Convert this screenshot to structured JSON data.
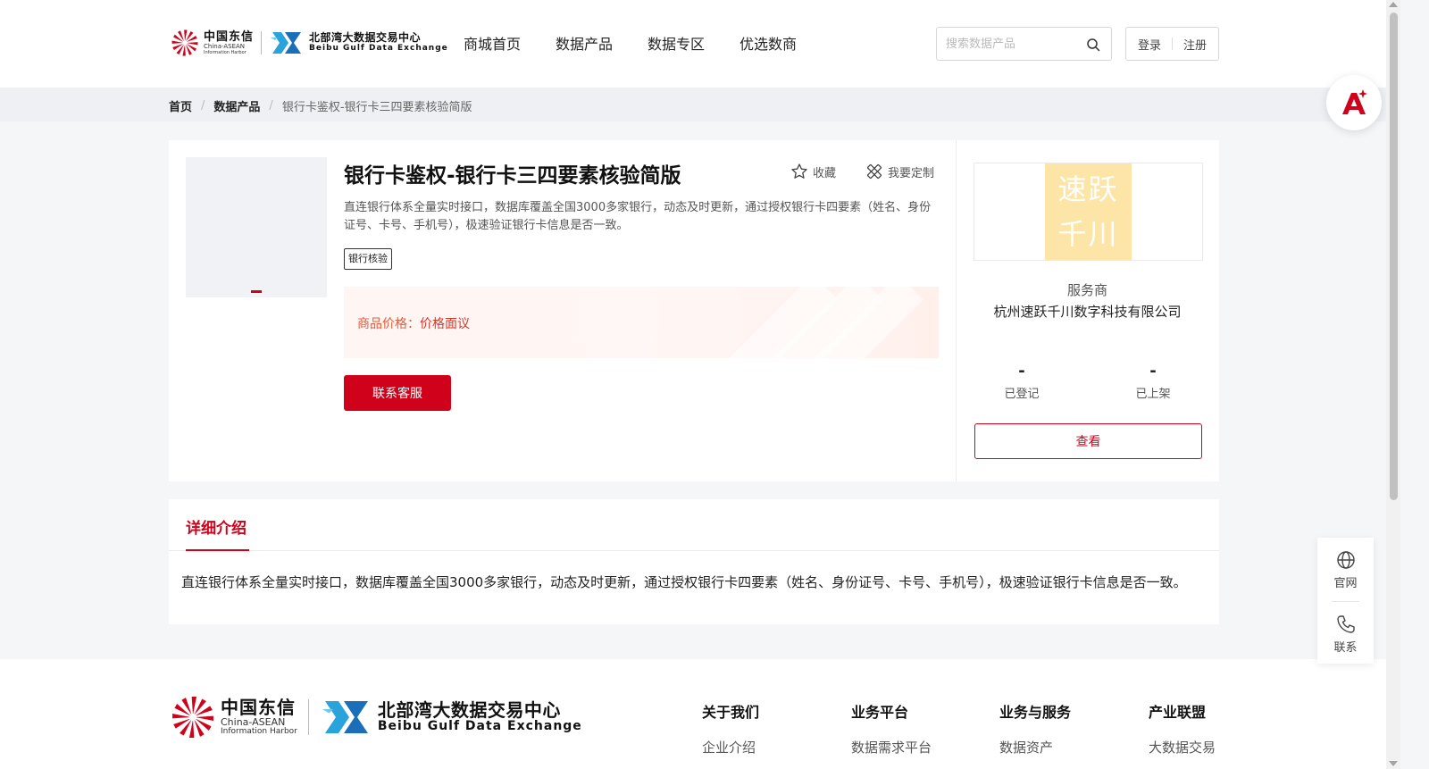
{
  "header": {
    "logo_china_telecom": {
      "cn": "中国东信",
      "en1": "China-ASEAN",
      "en2": "Information Harbor"
    },
    "logo_exchange": {
      "cn": "北部湾大数据交易中心",
      "en": "Beibu Gulf Data Exchange"
    },
    "nav": [
      {
        "label": "商城首页"
      },
      {
        "label": "数据产品"
      },
      {
        "label": "数据专区"
      },
      {
        "label": "优选数商"
      }
    ],
    "search_placeholder": "搜索数据产品",
    "login_label": "登录",
    "register_label": "注册"
  },
  "breadcrumb": {
    "home": "首页",
    "category": "数据产品",
    "current": "银行卡鉴权-银行卡三四要素核验简版",
    "separator": "/"
  },
  "product": {
    "title": "银行卡鉴权-银行卡三四要素核验简版",
    "favorite_label": "收藏",
    "customize_label": "我要定制",
    "description": "直连银行体系全量实时接口，数据库覆盖全国3000多家银行，动态及时更新，通过授权银行卡四要素（姓名、身份证号、卡号、手机号），极速验证银行卡信息是否一致。",
    "tag": "银行核验",
    "price_label": "商品价格：",
    "price_value": "价格面议",
    "contact_button": "联系客服"
  },
  "vendor": {
    "logo_line1": "速跃",
    "logo_line2": "千川",
    "role": "服务商",
    "name": "杭州速跃千川数字科技有限公司",
    "registered_value": "-",
    "registered_label": "已登记",
    "listed_value": "-",
    "listed_label": "已上架",
    "view_button": "查看"
  },
  "detail": {
    "tab_label": "详细介绍",
    "text": "直连银行体系全量实时接口，数据库覆盖全国3000多家银行，动态及时更新，通过授权银行卡四要素（姓名、身份证号、卡号、手机号），极速验证银行卡信息是否一致。"
  },
  "footer": {
    "columns": [
      {
        "heading": "关于我们",
        "item": "企业介绍"
      },
      {
        "heading": "业务平台",
        "item": "数据需求平台"
      },
      {
        "heading": "业务与服务",
        "item": "数据资产"
      },
      {
        "heading": "产业联盟",
        "item": "大数据交易"
      }
    ]
  },
  "side_float": {
    "website_label": "官网",
    "contact_label": "联系"
  },
  "colors": {
    "brand_red": "#d0021b",
    "price_orange": "#e55a3a",
    "vendor_logo_bg": "#fde5a8"
  }
}
